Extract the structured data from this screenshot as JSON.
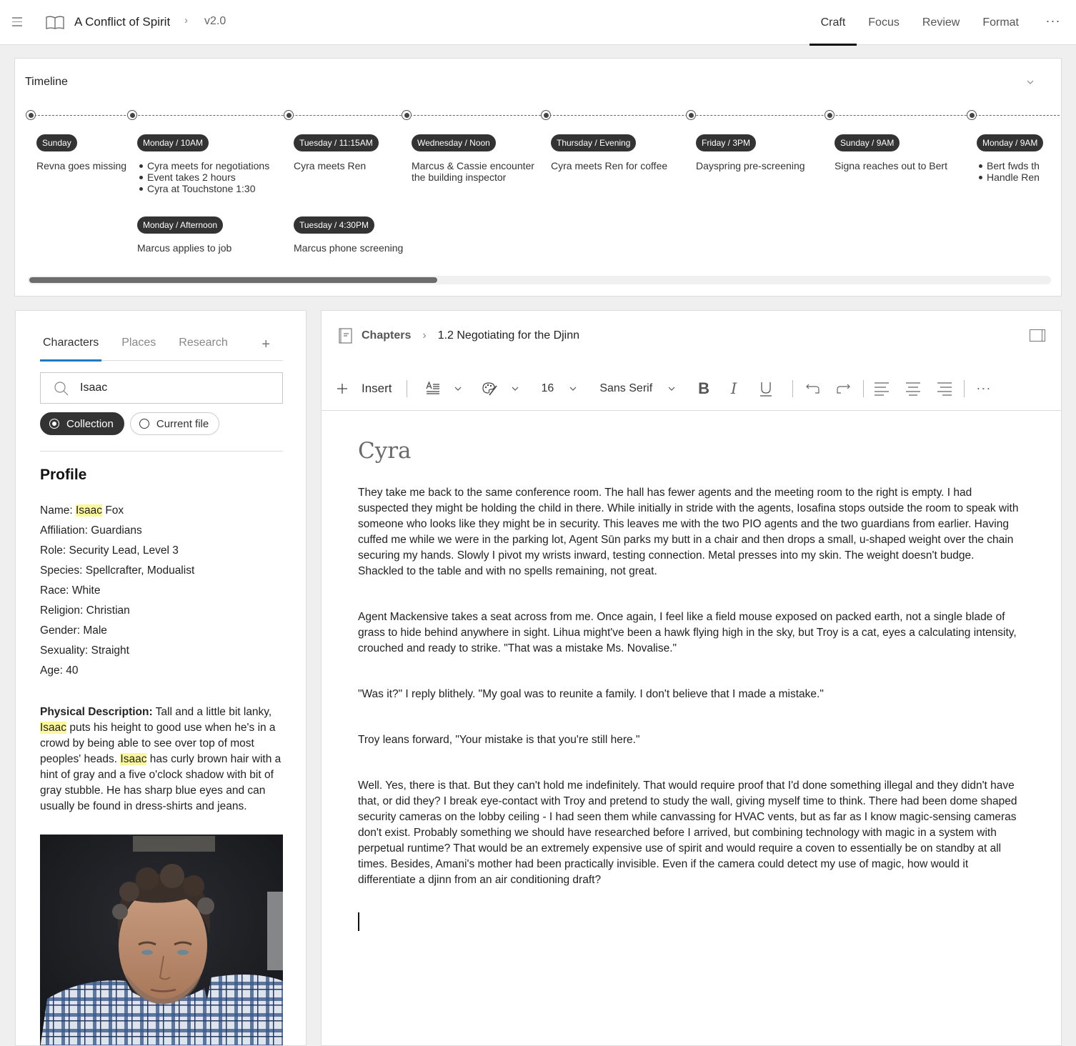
{
  "topbar": {
    "menu_icon": "hamburger-icon",
    "book_icon": "book-icon",
    "title": "A Conflict of Spirit",
    "version": "v2.0",
    "tabs": [
      {
        "label": "Craft",
        "active": true
      },
      {
        "label": "Focus",
        "active": false
      },
      {
        "label": "Review",
        "active": false
      },
      {
        "label": "Format",
        "active": false
      }
    ],
    "more_label": "···"
  },
  "timeline": {
    "title": "Timeline",
    "scroll_fraction_visible": 0.4,
    "scroll_position": 0,
    "events": [
      {
        "when": "Sunday",
        "text": "Revna goes missing"
      },
      {
        "when": "Monday / 10AM",
        "bullets": [
          "Cyra meets for negotiations",
          "Event takes 2 hours",
          "Cyra at Touchstone 1:30"
        ]
      },
      {
        "when": "Monday / Afternoon",
        "text": "Marcus applies to job"
      },
      {
        "when": "Tuesday / 11:15AM",
        "text": "Cyra meets Ren"
      },
      {
        "when": "Tuesday / 4:30PM",
        "text": "Marcus phone screening"
      },
      {
        "when": "Wednesday / Noon",
        "text": "Marcus & Cassie encounter the building inspector"
      },
      {
        "when": "Thursday / Evening",
        "text": "Cyra meets Ren for coffee"
      },
      {
        "when": "Friday / 3PM",
        "text": "Dayspring pre-screening"
      },
      {
        "when": "Sunday / 9AM",
        "text": "Signa reaches out to Bert"
      },
      {
        "when": "Monday / 9AM",
        "bullets": [
          "Bert fwds th",
          "Handle Ren"
        ]
      }
    ]
  },
  "sidebar": {
    "tabs": [
      {
        "label": "Characters",
        "active": true
      },
      {
        "label": "Places",
        "active": false
      },
      {
        "label": "Research",
        "active": false
      }
    ],
    "add_label": "+",
    "search": {
      "value": "Isaac",
      "placeholder": "Search"
    },
    "scope": [
      {
        "label": "Collection",
        "selected": true
      },
      {
        "label": "Current file",
        "selected": false
      }
    ],
    "profile": {
      "heading": "Profile",
      "highlight_term": "Isaac",
      "fields": [
        {
          "label": "Name:",
          "pre": "",
          "hl": "Isaac",
          "post": " Fox"
        },
        {
          "label": "Affiliation:",
          "value": "Guardians"
        },
        {
          "label": "Role:",
          "value": "Security Lead, Level 3"
        },
        {
          "label": "Species:",
          "value": "Spellcrafter, Modualist"
        },
        {
          "label": "Race:",
          "value": "White"
        },
        {
          "label": "Religion:",
          "value": "Christian"
        },
        {
          "label": "Gender:",
          "value": "Male"
        },
        {
          "label": "Sexuality:",
          "value": "Straight"
        },
        {
          "label": "Age:",
          "value": "40"
        }
      ],
      "description": {
        "label": "Physical Description:",
        "seg1": " Tall and a little bit lanky, ",
        "hl1": "Isaac",
        "seg2": " puts his height to good use when he's in a crowd by being able to see over top of most peoples' heads. ",
        "hl2": "Isaac",
        "seg3": " has curly brown hair with a hint of gray and a five o'clock shadow with bit of gray stubble. He has sharp blue eyes and can usually be found in dress-shirts and jeans."
      },
      "photo_alt": "Portrait of Isaac Fox"
    }
  },
  "editor": {
    "breadcrumb": {
      "root": "Chapters",
      "current": "1.2 Negotiating for the Djinn"
    },
    "toolbar": {
      "insert_label": "Insert",
      "font_size": "16",
      "font_family": "Sans Serif",
      "more_label": "···"
    },
    "doc": {
      "heading": "Cyra",
      "paragraphs": [
        "They take me back to the same conference room. The hall has fewer agents and the meeting room to the right is empty. I had suspected they might be holding the child in there. While initially in stride with the agents, Iosafina stops outside the room to speak with someone who looks like they might be in security. This leaves me with the two PIO agents and the two guardians from earlier. Having cuffed me while we were in the parking lot, Agent Sūn parks my butt in a chair and then drops a small, u-shaped weight over the chain securing my hands. Slowly I pivot my wrists inward, testing connection. Metal presses into my skin. The weight doesn't budge. Shackled to the table and with no spells remaining, not great.",
        "Agent Mackensive takes a seat across from me. Once again, I feel like a field mouse exposed on packed earth, not a single blade of grass to hide behind anywhere in sight. Lihua might've been a hawk flying high in the sky, but Troy is a cat, eyes a calculating intensity, crouched and ready to strike. \"That was a mistake Ms. Novalise.\"",
        "\"Was it?\" I reply blithely. \"My goal was to reunite a family. I don't believe that I made a mistake.\"",
        "Troy leans forward, \"Your mistake is that you're still here.\"",
        "Well. Yes, there is that. But they can't hold me indefinitely. That would require proof that I'd done something illegal and they didn't have that, or did they? I break eye-contact with Troy and pretend to study the wall, giving myself time to think. There had been dome shaped security cameras on the lobby ceiling - I had seen them while canvassing for HVAC vents, but as far as I know magic-sensing cameras don't exist. Probably something we should have researched before I arrived, but combining technology with magic in a system with perpetual runtime? That would be an extremely expensive use of spirit and would require a coven to essentially be on standby at all times. Besides, Amani's mother had been practically invisible. Even if the camera could detect my use of magic, how would it differentiate a djinn from an air conditioning draft?"
      ]
    }
  },
  "colors": {
    "accent_tab_underline": "#1f7ac4",
    "highlight": "#fbf79b",
    "pill_bg": "#333333",
    "active_tab_underline": "#111111"
  }
}
